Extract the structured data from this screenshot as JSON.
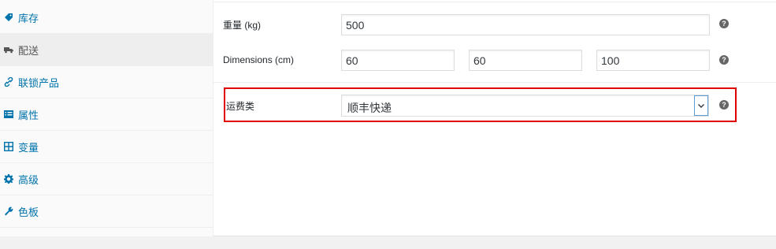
{
  "sidebar": {
    "items": [
      {
        "label": "库存",
        "icon": "tag-icon"
      },
      {
        "label": "配送",
        "icon": "truck-icon",
        "active": true
      },
      {
        "label": "联锁产品",
        "icon": "link-icon"
      },
      {
        "label": "属性",
        "icon": "list-icon"
      },
      {
        "label": "变量",
        "icon": "grid-icon"
      },
      {
        "label": "高级",
        "icon": "gear-icon"
      },
      {
        "label": "色板",
        "icon": "wrench-icon"
      }
    ]
  },
  "shipping": {
    "weight": {
      "label": "重量 (kg)",
      "value": "500"
    },
    "dimensions": {
      "label": "Dimensions (cm)",
      "length": "60",
      "width": "60",
      "height": "100"
    },
    "shipping_class": {
      "label": "运费类",
      "value": "顺丰快递"
    },
    "help_glyph": "?"
  },
  "colors": {
    "link": "#0073aa",
    "highlight": "#e00000",
    "focus": "#5b9dd9"
  }
}
